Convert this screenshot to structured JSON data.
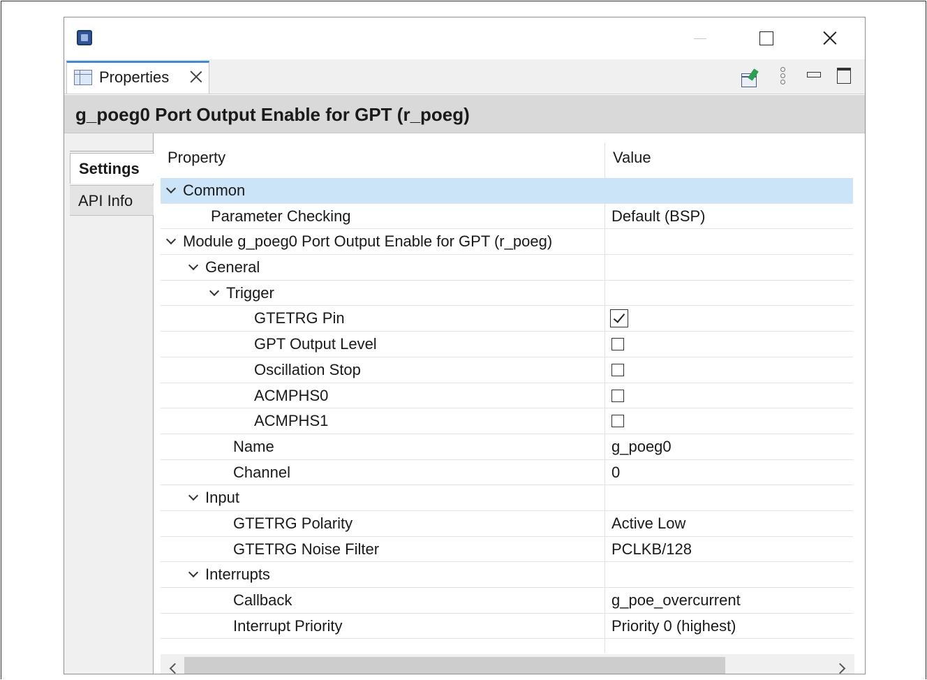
{
  "window": {
    "app_icon": "renesas-chip-icon"
  },
  "tab": {
    "label": "Properties",
    "icon": "properties-table-icon"
  },
  "toolbar": {
    "pin_icon": "pin-to-selection-icon",
    "menu_icon": "view-menu-icon"
  },
  "heading": "g_poeg0 Port Output Enable for GPT (r_poeg)",
  "side_tabs": {
    "settings": "Settings",
    "api_info": "API Info"
  },
  "table": {
    "headers": {
      "property": "Property",
      "value": "Value"
    },
    "rows": [
      {
        "level": 0,
        "expander": true,
        "property": "Common",
        "value": "",
        "type": "text",
        "selected": true
      },
      {
        "level": 2,
        "expander": false,
        "property": "Parameter Checking",
        "value": "Default (BSP)",
        "type": "text"
      },
      {
        "level": 0,
        "expander": true,
        "property": "Module g_poeg0 Port Output Enable for GPT (r_poeg)",
        "value": "",
        "type": "text"
      },
      {
        "level": 1,
        "expander": true,
        "property": "General",
        "value": "",
        "type": "text"
      },
      {
        "level": 2,
        "expander": true,
        "property": "Trigger",
        "value": "",
        "type": "text"
      },
      {
        "level": 4,
        "expander": false,
        "property": "GTETRG Pin",
        "value": true,
        "type": "checkbox"
      },
      {
        "level": 4,
        "expander": false,
        "property": "GPT Output Level",
        "value": false,
        "type": "checkbox"
      },
      {
        "level": 4,
        "expander": false,
        "property": "Oscillation Stop",
        "value": false,
        "type": "checkbox"
      },
      {
        "level": 4,
        "expander": false,
        "property": "ACMPHS0",
        "value": false,
        "type": "checkbox"
      },
      {
        "level": 4,
        "expander": false,
        "property": "ACMPHS1",
        "value": false,
        "type": "checkbox"
      },
      {
        "level": 3,
        "expander": false,
        "property": "Name",
        "value": "g_poeg0",
        "type": "text"
      },
      {
        "level": 3,
        "expander": false,
        "property": "Channel",
        "value": "0",
        "type": "text"
      },
      {
        "level": 1,
        "expander": true,
        "property": "Input",
        "value": "",
        "type": "text"
      },
      {
        "level": 3,
        "expander": false,
        "property": "GTETRG Polarity",
        "value": "Active Low",
        "type": "text"
      },
      {
        "level": 3,
        "expander": false,
        "property": "GTETRG Noise Filter",
        "value": "PCLKB/128",
        "type": "text"
      },
      {
        "level": 1,
        "expander": true,
        "property": "Interrupts",
        "value": "",
        "type": "text"
      },
      {
        "level": 3,
        "expander": false,
        "property": "Callback",
        "value": "g_poe_overcurrent",
        "type": "text"
      },
      {
        "level": 3,
        "expander": false,
        "property": "Interrupt Priority",
        "value": "Priority 0 (highest)",
        "type": "text"
      }
    ]
  },
  "colors": {
    "selected_row": "#cce4f7",
    "tab_accent": "#3c8ae0",
    "heading_bg": "#d9d9d9"
  }
}
